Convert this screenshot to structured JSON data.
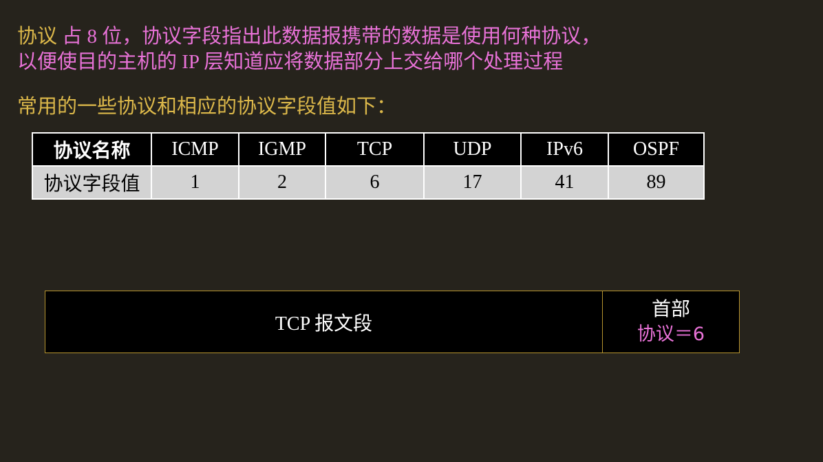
{
  "intro": {
    "line1_highlight": "协议",
    "line1_rest": " 占 8 位，协议字段指出此数据报携带的数据是使用何种协议，",
    "line2": "以便使目的主机的 IP 层知道应将数据部分上交给哪个处理过程",
    "line3": "常用的一些协议和相应的协议字段值如下："
  },
  "table": {
    "header_label": "协议名称",
    "headers": [
      "ICMP",
      "IGMP",
      "TCP",
      "UDP",
      "IPv6",
      "OSPF"
    ],
    "row_label": "协议字段值",
    "values": [
      "1",
      "2",
      "6",
      "17",
      "41",
      "89"
    ]
  },
  "datagram": {
    "payload_label": "TCP 报文段",
    "header_label": "首部",
    "header_field": "协议＝6"
  },
  "colors": {
    "background": "#26231c",
    "pink_text": "#e872d7",
    "gold_text": "#dcb84a",
    "box_border": "#b8952f",
    "table_value_row": "#d3d3d3"
  }
}
